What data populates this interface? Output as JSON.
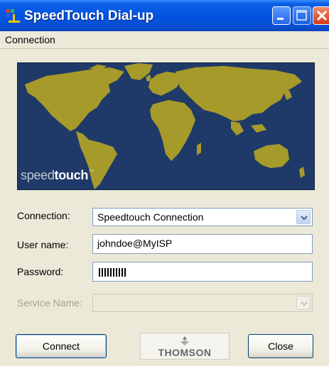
{
  "window": {
    "title": "SpeedTouch Dial-up"
  },
  "menu": {
    "items": [
      "Connection"
    ]
  },
  "banner": {
    "logo_light": "speed",
    "logo_bold": "touch",
    "logo_mark": "™"
  },
  "form": {
    "connection_label": "Connection:",
    "connection_value": "Speedtouch Connection",
    "username_label": "User name:",
    "username_value": "johndoe@MyISP",
    "password_label": "Password:",
    "service_label": "Service Name:",
    "service_value": ""
  },
  "buttons": {
    "connect": "Connect",
    "close": "Close"
  },
  "brand": {
    "name": "THOMSON"
  },
  "colors": {
    "titlebar": "#0453e0",
    "banner_bg": "#1f3a68",
    "land": "#a69a2a"
  }
}
